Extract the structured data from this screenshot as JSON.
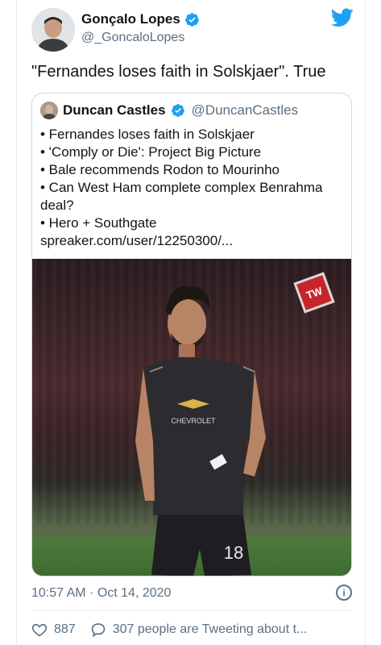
{
  "tweet": {
    "author_name": "Gonçalo Lopes",
    "author_handle": "@_GoncaloLopes",
    "text": "\"Fernandes loses faith in Solskjaer\". True"
  },
  "quoted": {
    "author_name": "Duncan Castles",
    "author_handle": "@DuncanCastles",
    "lines": [
      "• Fernandes loses faith in Solskjaer",
      "• 'Comply or Die': Project Big Picture",
      "• Bale recommends Rodon to Mourinho",
      "• Can West Ham complete complex Benrahma deal?",
      "• Hero + Southgate",
      "spreaker.com/user/12250300/..."
    ],
    "image": {
      "watermark": "TW",
      "sponsor": "CHEVROLET",
      "shirt_number": "18"
    }
  },
  "meta": {
    "timestamp": "10:57 AM · Oct 14, 2020",
    "info_glyph": "i"
  },
  "actions": {
    "likes": "887",
    "tweeting": "307 people are Tweeting about t..."
  },
  "colors": {
    "verified": "#1da1f2",
    "bird": "#1da1f2",
    "secondary_text": "#5b7083"
  },
  "icons": {
    "verified": "verified-badge-icon",
    "bird": "twitter-bird-icon",
    "heart": "heart-icon",
    "reply": "speech-bubble-icon",
    "info": "info-icon"
  }
}
